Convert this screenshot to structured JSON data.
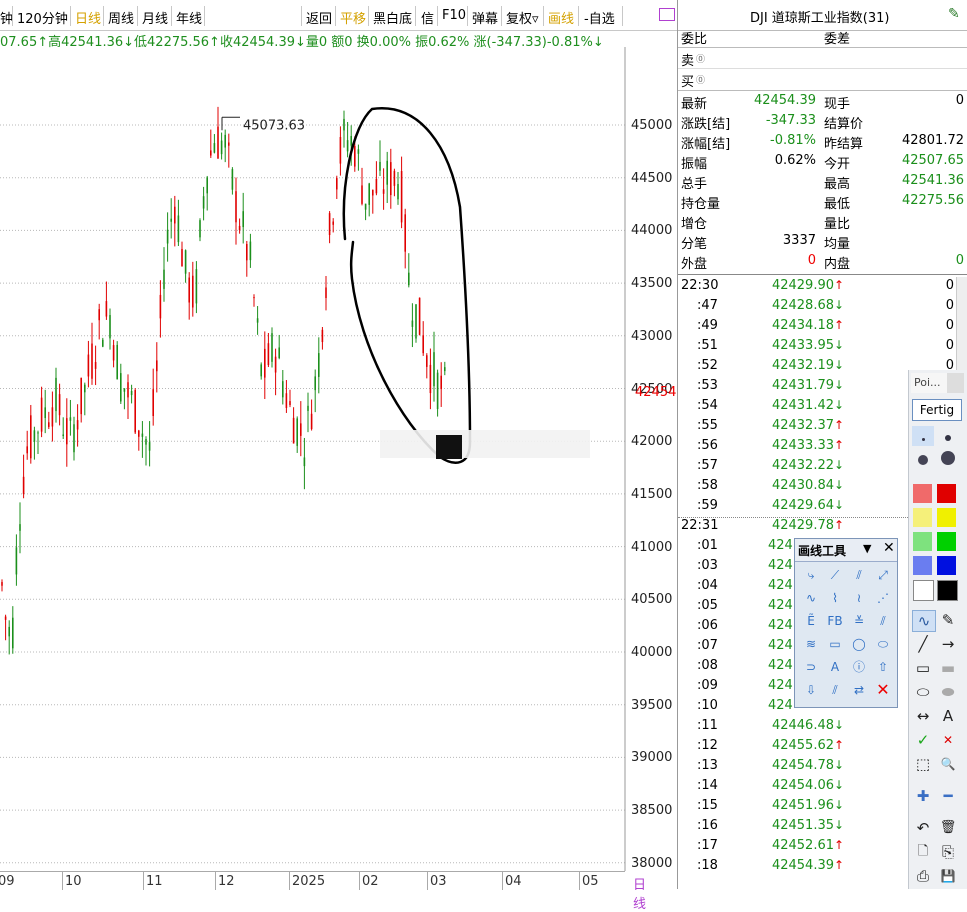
{
  "toolbar": {
    "items": [
      "钟",
      "120分钟",
      "日线",
      "周线",
      "月线",
      "年线",
      "返回",
      "平移",
      "黑白底",
      "信",
      "F10",
      "弹幕",
      "复权▿",
      "画线",
      "-自选"
    ]
  },
  "infoline": "07.65↑高42541.36↓低42275.56↑收42454.39↓量0 额0 换0.00% 振0.62% 涨(-347.33)-0.81%↓",
  "chart": {
    "high_label": "45073.63",
    "current_price_label": "42454",
    "price_axis": [
      "45000",
      "44500",
      "44000",
      "43500",
      "43000",
      "42500",
      "42000",
      "41500",
      "41000",
      "40500",
      "40000",
      "39500",
      "39000",
      "38500",
      "38000"
    ],
    "x_labels": [
      "09",
      "10",
      "11",
      "12",
      "2025",
      "02",
      "03",
      "04",
      "05"
    ],
    "period_label": "日线"
  },
  "panel": {
    "title": "DJI 道琼斯工业指数(31)",
    "weibi_label": "委比",
    "weicha_label": "委差",
    "sell_label": "卖",
    "buy_label": "买",
    "stats": [
      {
        "l1": "最新",
        "v1": "42454.39",
        "c1": "green",
        "l2": "现手",
        "v2": "0",
        "c2": ""
      },
      {
        "l1": "涨跌[结]",
        "v1": "-347.33",
        "c1": "green",
        "l2": "结算价",
        "v2": "",
        "c2": ""
      },
      {
        "l1": "涨幅[结]",
        "v1": "-0.81%",
        "c1": "green",
        "l2": "昨结算",
        "v2": "42801.72",
        "c2": ""
      },
      {
        "l1": "振幅",
        "v1": "0.62%",
        "c1": "",
        "l2": "今开",
        "v2": "42507.65",
        "c2": "green"
      },
      {
        "l1": "总手",
        "v1": "",
        "c1": "",
        "l2": "最高",
        "v2": "42541.36",
        "c2": "green"
      },
      {
        "l1": "持仓量",
        "v1": "",
        "c1": "",
        "l2": "最低",
        "v2": "42275.56",
        "c2": "green"
      },
      {
        "l1": "增仓",
        "v1": "",
        "c1": "",
        "l2": "量比",
        "v2": "",
        "c2": ""
      },
      {
        "l1": "分笔",
        "v1": "3337",
        "c1": "",
        "l2": "均量",
        "v2": "",
        "c2": ""
      },
      {
        "l1": "外盘",
        "v1": "0",
        "c1": "red",
        "l2": "内盘",
        "v2": "0",
        "c2": "green"
      }
    ],
    "ticks": [
      {
        "t": "22:30",
        "p": "42429.90",
        "a": "↑",
        "v": "0"
      },
      {
        "t": ":47",
        "p": "42428.68",
        "a": "↓",
        "v": "0"
      },
      {
        "t": ":49",
        "p": "42434.18",
        "a": "↑",
        "v": "0"
      },
      {
        "t": ":51",
        "p": "42433.95",
        "a": "↓",
        "v": "0"
      },
      {
        "t": ":52",
        "p": "42432.19",
        "a": "↓",
        "v": "0"
      },
      {
        "t": ":53",
        "p": "42431.79",
        "a": "↓",
        "v": ""
      },
      {
        "t": ":54",
        "p": "42431.42",
        "a": "↓",
        "v": ""
      },
      {
        "t": ":55",
        "p": "42432.37",
        "a": "↑",
        "v": ""
      },
      {
        "t": ":56",
        "p": "42433.33",
        "a": "↑",
        "v": ""
      },
      {
        "t": ":57",
        "p": "42432.22",
        "a": "↓",
        "v": ""
      },
      {
        "t": ":58",
        "p": "42430.84",
        "a": "↓",
        "v": ""
      },
      {
        "t": ":59",
        "p": "42429.64",
        "a": "↓",
        "v": ""
      },
      {
        "t": "22:31",
        "p": "42429.78",
        "a": "↑",
        "v": ""
      },
      {
        "t": ":01",
        "p": "424",
        "a": "",
        "v": ""
      },
      {
        "t": ":03",
        "p": "424",
        "a": "",
        "v": ""
      },
      {
        "t": ":04",
        "p": "424",
        "a": "",
        "v": ""
      },
      {
        "t": ":05",
        "p": "424",
        "a": "",
        "v": ""
      },
      {
        "t": ":06",
        "p": "424",
        "a": "",
        "v": ""
      },
      {
        "t": ":07",
        "p": "424",
        "a": "",
        "v": ""
      },
      {
        "t": ":08",
        "p": "424",
        "a": "",
        "v": ""
      },
      {
        "t": ":09",
        "p": "424",
        "a": "",
        "v": ""
      },
      {
        "t": ":10",
        "p": "424",
        "a": "",
        "v": ""
      },
      {
        "t": ":11",
        "p": "42446.48",
        "a": "↓",
        "v": ""
      },
      {
        "t": ":12",
        "p": "42455.62",
        "a": "↑",
        "v": ""
      },
      {
        "t": ":13",
        "p": "42454.78",
        "a": "↓",
        "v": ""
      },
      {
        "t": ":14",
        "p": "42454.06",
        "a": "↓",
        "v": ""
      },
      {
        "t": ":15",
        "p": "42451.96",
        "a": "↓",
        "v": ""
      },
      {
        "t": ":16",
        "p": "42451.35",
        "a": "↓",
        "v": ""
      },
      {
        "t": ":17",
        "p": "42452.61",
        "a": "↑",
        "v": ""
      },
      {
        "t": ":18",
        "p": "42454.39",
        "a": "↑",
        "v": ""
      }
    ]
  },
  "drawtools": {
    "title": "画线工具"
  },
  "palette": {
    "poi_label": "Poi...",
    "fertig_label": "Fertig"
  },
  "colors": {
    "up": "#e00000",
    "down": "#1b8f1b",
    "accent": "#d4a100"
  }
}
